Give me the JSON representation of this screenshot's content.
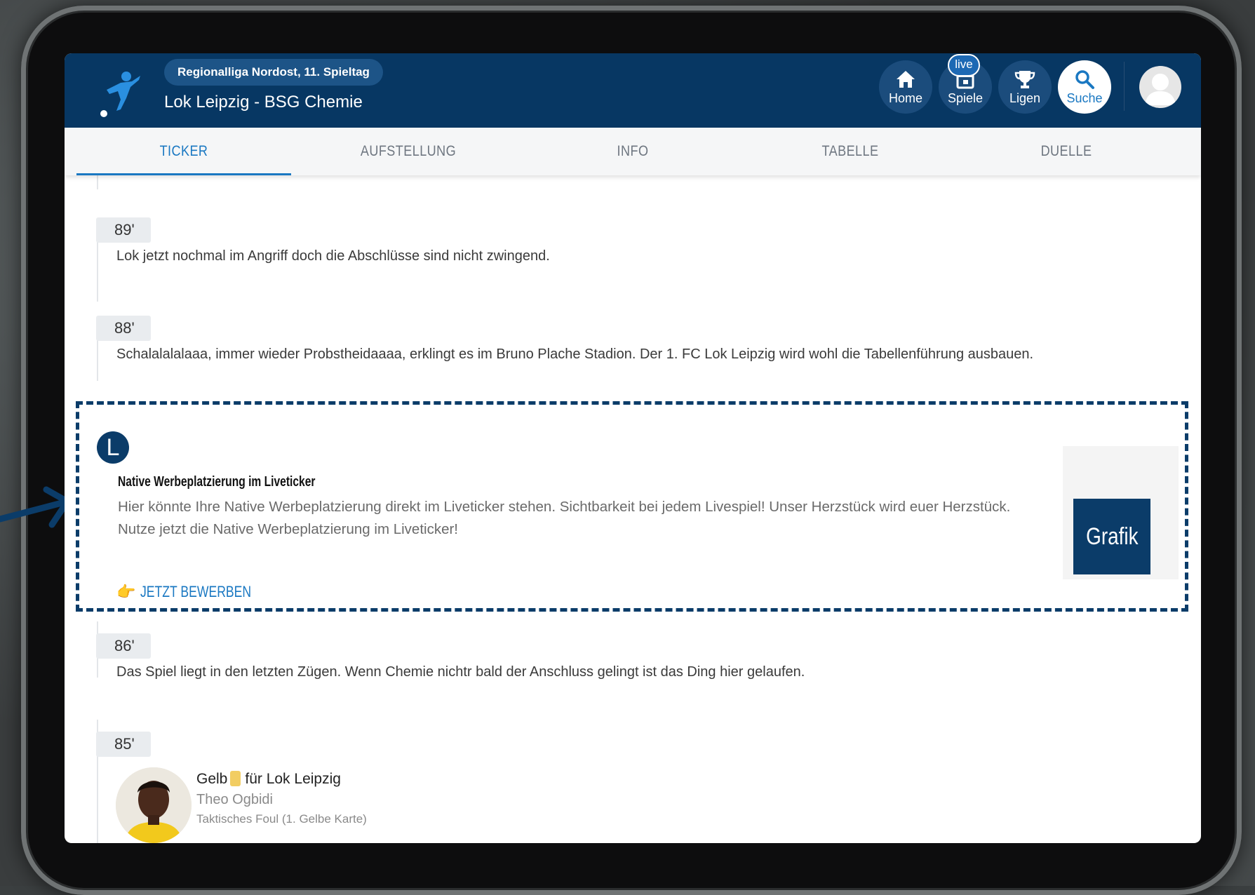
{
  "header": {
    "league_label": "Regionalliga Nordost, 11. Spieltag",
    "match_title": "Lok Leipzig - BSG Chemie",
    "live_badge": "live",
    "nav": [
      {
        "label": "Home",
        "icon": "home-icon"
      },
      {
        "label": "Spiele",
        "icon": "calendar-icon"
      },
      {
        "label": "Ligen",
        "icon": "trophy-icon"
      },
      {
        "label": "Suche",
        "icon": "search-icon"
      }
    ]
  },
  "tabs": [
    "TICKER",
    "AUFSTELLUNG",
    "INFO",
    "TABELLE",
    "DUELLE"
  ],
  "ticker": [
    {
      "minute": "89'",
      "text": "Lok jetzt nochmal im Angriff doch die Abschlüsse sind nicht zwingend."
    },
    {
      "minute": "88'",
      "text": "Schalalalalaaa, immer wieder Probstheidaaaa, erklingt es im Bruno Plache Stadion. Der 1. FC Lok Leipzig wird wohl die Tabellenführung ausbauen."
    },
    {
      "minute": "86'",
      "text": "Das Spiel liegt in den letzten Zügen. Wenn Chemie nichtr bald der Anschluss gelingt ist das Ding hier gelaufen."
    },
    {
      "minute": "85'",
      "card_prefix": "Gelb",
      "card_suffix": "für Lok Leipzig",
      "player": "Theo Ogbidi",
      "detail": "Taktisches Foul (1. Gelbe Karte)"
    }
  ],
  "ad": {
    "badge": "L",
    "title": "Native Werbeplatzierung im Liveticker",
    "text": "Hier könnte Ihre Native Werbeplatzierung  direkt im Liveticker stehen. Sichtbarkeit bei jedem Livespiel! Unser Herzstück wird euer Herzstück. Nutze jetzt die Native Werbeplatzierung im Liveticker!",
    "cta": "JETZT BEWERBEN",
    "cta_icon": "pointing-hand-icon",
    "graphic_label": "Grafik"
  },
  "colors": {
    "header_bg": "#073763",
    "accent_blue": "#1a78c2",
    "ad_border": "#0b3c69",
    "yellow_card": "#f2cd62"
  }
}
